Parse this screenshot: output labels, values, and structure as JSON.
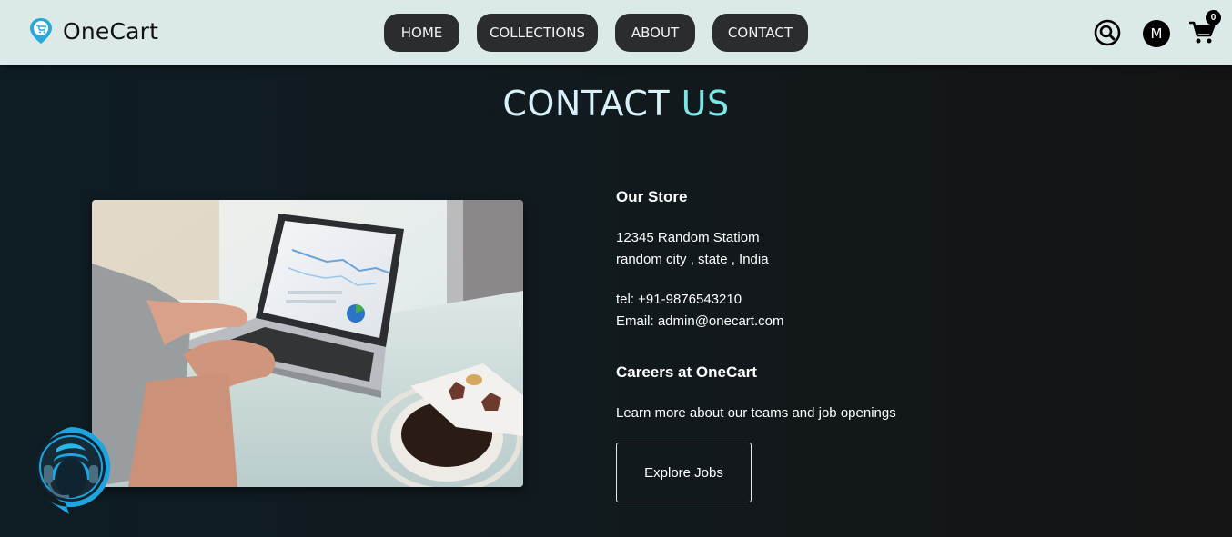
{
  "brand": {
    "name": "OneCart"
  },
  "nav": {
    "links": [
      {
        "label": "HOME"
      },
      {
        "label": "COLLECTIONS"
      },
      {
        "label": "ABOUT"
      },
      {
        "label": "CONTACT"
      }
    ],
    "user_initial": "M",
    "cart_count": "0",
    "icons": {
      "search": "search-icon",
      "cart": "cart-icon"
    }
  },
  "page": {
    "heading_part1": "CONTACT",
    "heading_part2": "US"
  },
  "store": {
    "title": "Our Store",
    "address_line1": "12345 Random Statiom",
    "address_line2": "random city , state , India",
    "phone": "tel: +91-9876543210",
    "email": "Email: admin@onecart.com"
  },
  "careers": {
    "title": "Careers at OneCart",
    "text": "Learn more about our teams and job openings",
    "button_label": "Explore Jobs"
  },
  "colors": {
    "navbar_bg": "#dce9e9",
    "nav_button": "#2a2c2e",
    "heading_primary": "#d8f1fb",
    "heading_accent": "#7ae7e7",
    "support_ring": "#1ea5e0"
  },
  "support": {
    "icon": "customer-support-icon"
  }
}
